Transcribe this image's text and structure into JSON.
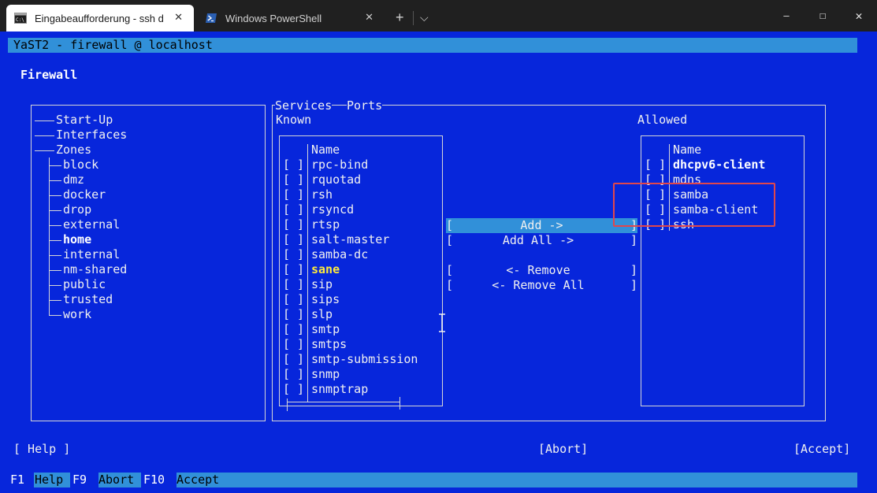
{
  "window": {
    "tabs": [
      {
        "label": "Eingabeaufforderung - ssh  d",
        "active": true
      },
      {
        "label": "Windows PowerShell",
        "active": false
      }
    ],
    "new_tab": "+",
    "dropdown": "⌵",
    "close_tab": "✕",
    "minimize": "—",
    "maximize": "☐",
    "close_window": "✕"
  },
  "terminal": {
    "title": "YaST2 - firewall @ localhost",
    "heading": "Firewall",
    "tree": [
      "Start-Up",
      "Interfaces",
      "Zones"
    ],
    "zones": [
      "block",
      "dmz",
      "docker",
      "drop",
      "external",
      "home",
      "internal",
      "nm-shared",
      "public",
      "trusted",
      "work"
    ],
    "selected_zone": "home",
    "tabs_label": {
      "services": "Services",
      "ports": "Ports"
    },
    "known_label": "Known",
    "allowed_label": "Allowed",
    "column_name": "Name",
    "checkbox": "[ ]",
    "known": [
      "rpc-bind",
      "rquotad",
      "rsh",
      "rsyncd",
      "rtsp",
      "salt-master",
      "samba-dc",
      "sane",
      "sip",
      "sips",
      "slp",
      "smtp",
      "smtps",
      "smtp-submission",
      "snmp",
      "snmptrap"
    ],
    "known_highlight": "sane",
    "allowed": [
      "dhcpv6-client",
      "mdns",
      "samba",
      "samba-client",
      "ssh"
    ],
    "buttons": {
      "add": "Add ->",
      "add_all": "Add All ->",
      "remove": "<- Remove",
      "remove_all": "<- Remove All"
    },
    "bottom": {
      "help": "[ Help ]",
      "abort": "[Abort]",
      "accept": "[Accept]"
    },
    "fkeys": [
      {
        "key": "F1",
        "label": "Help"
      },
      {
        "key": "F9",
        "label": "Abort"
      },
      {
        "key": "F10",
        "label": "Accept"
      }
    ]
  },
  "colors": {
    "terminal_bg": "#0726db",
    "bar": "#3190d9",
    "annotation": "#e0474c"
  }
}
